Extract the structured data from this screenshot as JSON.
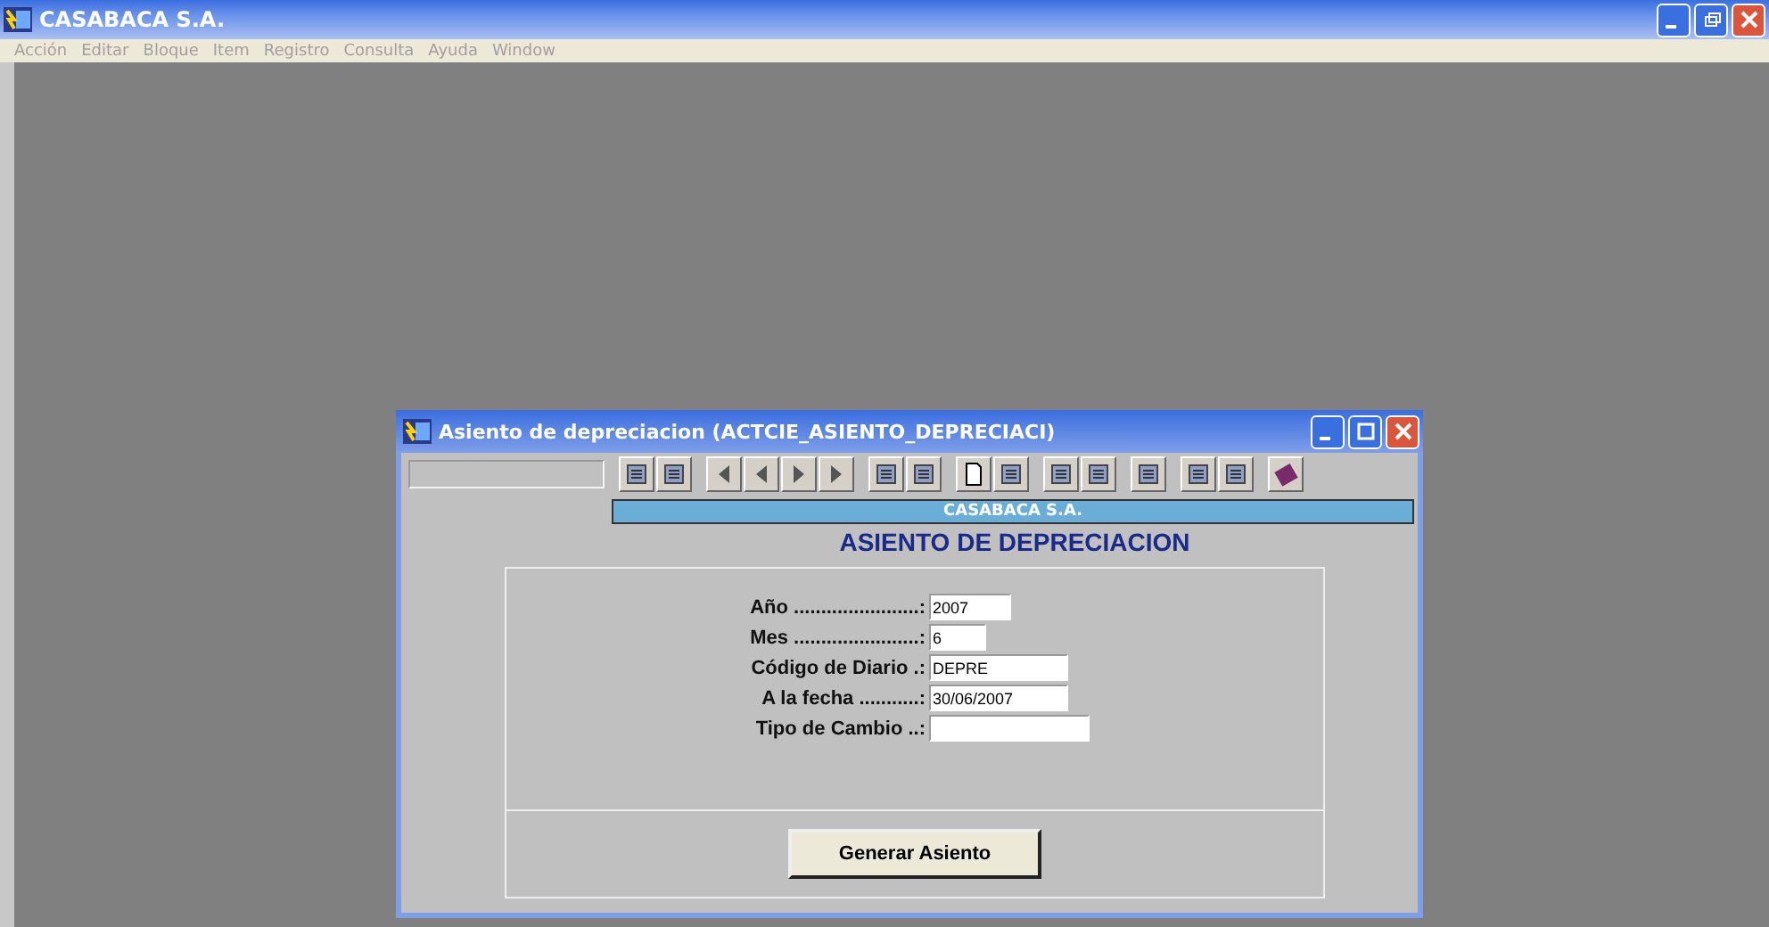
{
  "window": {
    "title": "CASABACA S.A."
  },
  "menu": [
    "Acción",
    "Editar",
    "Bloque",
    "Item",
    "Registro",
    "Consulta",
    "Ayuda",
    "Window"
  ],
  "dialog": {
    "title": "Asiento de depreciacion (ACTCIE_ASIENTO_DEPRECIACI)",
    "company": "CASABACA S.A.",
    "heading": "ASIENTO DE DEPRECIACION",
    "fields": [
      {
        "label": "Año .......................:",
        "value": "2007"
      },
      {
        "label": "Mes .......................:",
        "value": "6"
      },
      {
        "label": "Código de Diario .:",
        "value": "DEPRE"
      },
      {
        "label": "A la fecha ...........:",
        "value": "30/06/2007"
      },
      {
        "label": "Tipo de Cambio ..:"
      }
    ],
    "button": "Generar Asiento"
  }
}
